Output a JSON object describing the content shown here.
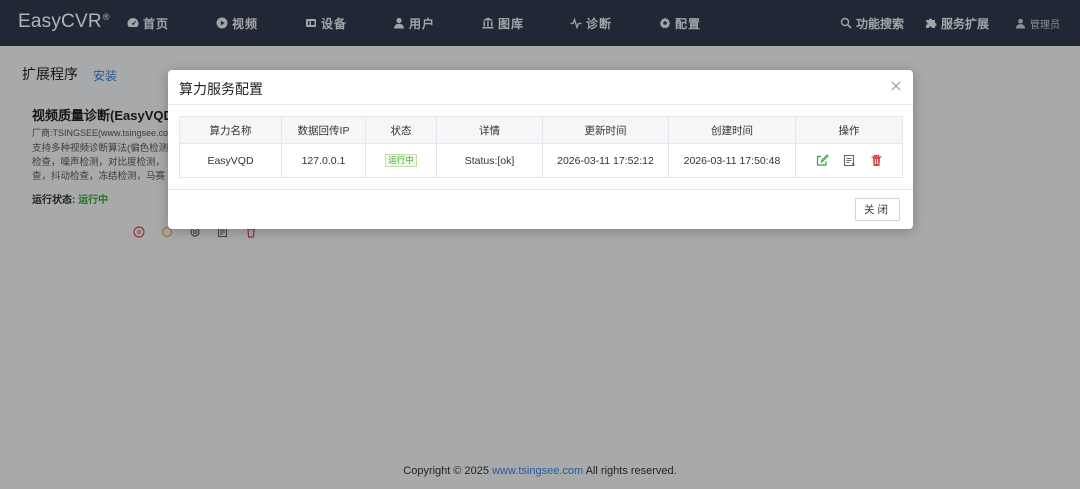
{
  "nav": {
    "brand": "EasyCVR",
    "brand_mark": "®",
    "items": [
      {
        "label": "首页",
        "icon": "dashboard-icon"
      },
      {
        "label": "视频",
        "icon": "play-icon"
      },
      {
        "label": "设备",
        "icon": "device-icon"
      },
      {
        "label": "用户",
        "icon": "user-icon"
      },
      {
        "label": "图库",
        "icon": "gallery-icon"
      },
      {
        "label": "诊断",
        "icon": "pulse-icon"
      },
      {
        "label": "配置",
        "icon": "gear-icon"
      }
    ],
    "search_label": "功能搜索",
    "extension_label": "服务扩展",
    "user_label": "管理员"
  },
  "page": {
    "title": "扩展程序",
    "install_link": "安装"
  },
  "card": {
    "title": "视频质量诊断(EasyVQD",
    "vendor": "厂商:TSINGSEE(www.tsingsee.co",
    "desc_lines": [
      "支持多种视频诊断算法(偏色检测",
      "检查，噪声检测，对比度检测，",
      "查，抖动检查，冻结检测，马赛"
    ],
    "status_label": "运行状态:",
    "status_value": "运行中"
  },
  "dialog": {
    "title": "算力服务配置",
    "columns": [
      "算力名称",
      "数据回传IP",
      "状态",
      "详情",
      "更新时间",
      "创建时间",
      "操作"
    ],
    "rows": [
      {
        "name": "EasyVQD",
        "ip": "127.0.0.1",
        "status": "运行中",
        "detail": "Status:[ok]",
        "updated": "2026-03-11 17:52:12",
        "created": "2026-03-11 17:50:48"
      }
    ],
    "close_button": "关闭"
  },
  "footer": {
    "prefix": "Copyright © 2025 ",
    "link": "www.tsingsee.com",
    "suffix": " All rights reserved."
  },
  "colors": {
    "topbar": "#2d3a4b",
    "accent_link": "#3b7fd9",
    "success": "#3aa53a",
    "danger": "#e04646"
  }
}
